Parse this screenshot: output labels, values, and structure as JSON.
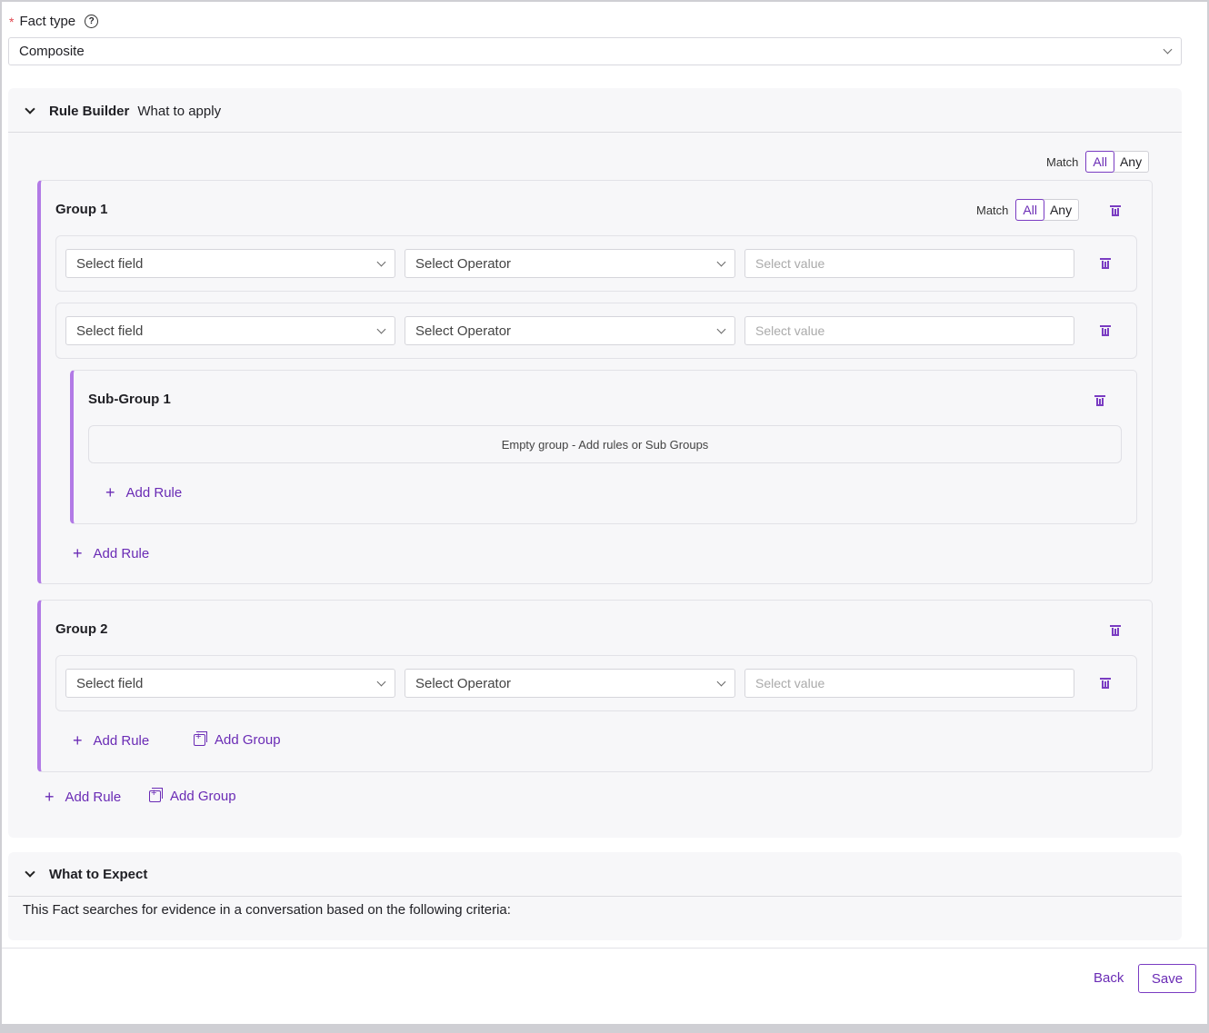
{
  "fact_type": {
    "required_mark": "*",
    "label": "Fact type",
    "help_icon": "?",
    "selected": "Composite"
  },
  "rule_builder": {
    "title": "Rule Builder",
    "subtitle": "What to apply",
    "match_label": "Match",
    "match_all": "All",
    "match_any": "Any",
    "add_rule": "Add Rule",
    "add_group": "Add Group",
    "group1": {
      "title": "Group 1",
      "match_label": "Match",
      "match_all": "All",
      "match_any": "Any",
      "rules": [
        {
          "field": "Select field",
          "operator": "Select Operator",
          "value_placeholder": "Select value"
        },
        {
          "field": "Select field",
          "operator": "Select Operator",
          "value_placeholder": "Select value"
        }
      ],
      "subgroup": {
        "title": "Sub-Group 1",
        "empty_text": "Empty group - Add rules or Sub Groups",
        "add_rule": "Add Rule"
      },
      "add_rule": "Add Rule"
    },
    "group2": {
      "title": "Group 2",
      "rules": [
        {
          "field": "Select field",
          "operator": "Select Operator",
          "value_placeholder": "Select value"
        }
      ],
      "add_rule": "Add Rule",
      "add_group": "Add Group"
    }
  },
  "what_to_expect": {
    "title": "What to Expect",
    "description": "This Fact searches for evidence in a conversation based on the following criteria:"
  },
  "footer": {
    "back": "Back",
    "save": "Save"
  }
}
